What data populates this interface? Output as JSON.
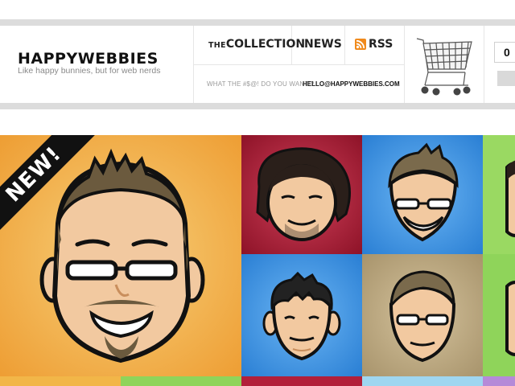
{
  "site": {
    "logo": "HAPPYWEBBIES",
    "tagline": "Like happy bunnies, but for web nerds"
  },
  "nav": {
    "collection_prefix": "THE",
    "collection_label": "COLLECTION",
    "news_label": "NEWS",
    "rss_label": "RSS",
    "rss_icon": "rss-icon"
  },
  "contact": {
    "question": "WHAT THE #$@! DO YOU WANT!?",
    "email": "HELLO@HAPPYWEBBIES.COM"
  },
  "cart": {
    "icon": "shopping-cart-icon",
    "count": "0"
  },
  "featured": {
    "badge": "NEW!"
  },
  "colors": {
    "header_rule": "#dcdcdc",
    "tile_orange": "#f2b648",
    "tile_crimson": "#b21f3a",
    "tile_blue": "#3b8fe0",
    "tile_green": "#8fd45a",
    "tile_tan": "#b8a47c",
    "skin": "#f2c9a0",
    "skin_shade": "#e5ad7d",
    "hair_brown": "#6b5a3e",
    "hair_black": "#2a1f1a"
  }
}
